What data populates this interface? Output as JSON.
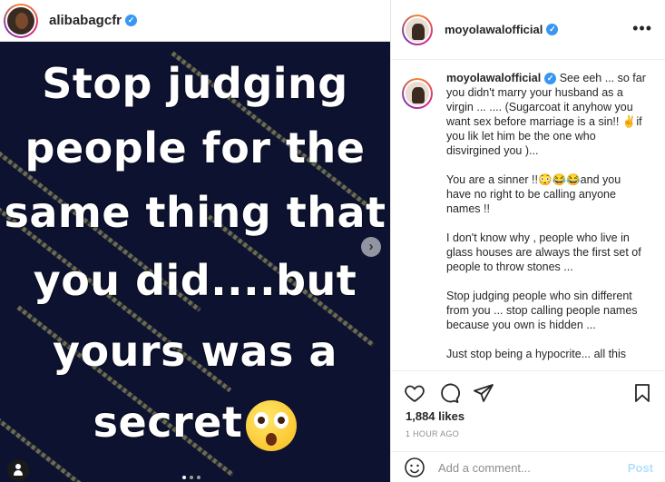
{
  "prev_post": {
    "username": "alibabagcfr",
    "verified_icon": "verified-badge-icon"
  },
  "image": {
    "lines": [
      "Stop judging",
      "people for the",
      "same thing that",
      "you did....but",
      "yours was a",
      "secret"
    ],
    "emoji": "flushed-face-emoji",
    "background_color": "#0d1230"
  },
  "post": {
    "username": "moyolawalofficial",
    "caption": {
      "username": "moyolawalofficial",
      "paragraphs": [
        "See eeh ... so far you didn't marry your husband as a virgin ... .... (Sugarcoat it anyhow you want sex before marriage is a sin!! ✌if you lik let him be the one who disvirgined you )...",
        "You are a sinner !!😳😂😂and you have no right to be calling anyone names !!",
        "I don't know why , people who live in glass houses are always the first set of people to throw stones ...",
        "Stop judging people who sin different from you ... stop calling people names because you own is hidden ...",
        "Just stop being a hypocrite... all this"
      ]
    },
    "likes": "1,884 likes",
    "timestamp": "1 HOUR AGO",
    "comment_placeholder": "Add a comment...",
    "post_label": "Post",
    "more_label": "•••"
  },
  "colors": {
    "link_disabled": "#b2dffc",
    "verified": "#3897f0",
    "muted": "#8e8e8e"
  }
}
